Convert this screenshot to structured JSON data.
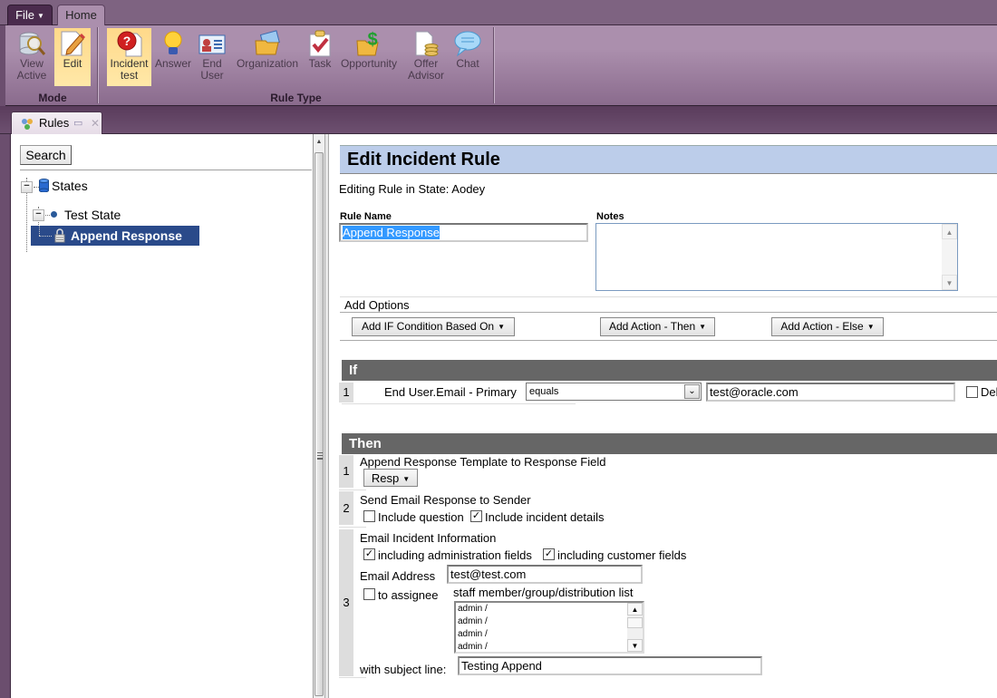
{
  "ribbon": {
    "file_tab": "File",
    "home_tab": "Home",
    "mode_group": {
      "label": "Mode",
      "buttons": [
        {
          "icon": "view-active-icon",
          "line1": "View",
          "line2": "Active",
          "active": false
        },
        {
          "icon": "edit-icon",
          "line1": "Edit",
          "line2": "",
          "active": true
        }
      ]
    },
    "rule_type_group": {
      "label": "Rule Type",
      "buttons": [
        {
          "icon": "incident-icon",
          "line1": "Incident",
          "line2": "test",
          "active": true
        },
        {
          "icon": "answer-icon",
          "line1": "Answer",
          "line2": "",
          "active": false
        },
        {
          "icon": "end-user-icon",
          "line1": "End",
          "line2": "User",
          "active": false
        },
        {
          "icon": "organization-icon",
          "line1": "Organization",
          "line2": "",
          "active": false
        },
        {
          "icon": "task-icon",
          "line1": "Task",
          "line2": "",
          "active": false
        },
        {
          "icon": "opportunity-icon",
          "line1": "Opportunity",
          "line2": "",
          "active": false
        },
        {
          "icon": "offer-advisor-icon",
          "line1": "Offer",
          "line2": "Advisor",
          "active": false
        },
        {
          "icon": "chat-icon",
          "line1": "Chat",
          "line2": "",
          "active": false
        }
      ]
    }
  },
  "doc_tab": {
    "label": "Rules"
  },
  "left_panel": {
    "search_button": "Search",
    "tree": {
      "root": "States",
      "child": "Test State",
      "selected_leaf": "Append Response"
    }
  },
  "editor": {
    "title": "Edit Incident Rule",
    "state_line": "Editing Rule in State: Aodey",
    "rule_name_label": "Rule Name",
    "rule_name_value": "Append Response",
    "notes_label": "Notes",
    "notes_value": "",
    "add_options_label": "Add Options",
    "add_if_button": "Add IF Condition Based On",
    "add_then_button": "Add Action - Then",
    "add_else_button": "Add Action - Else",
    "if_section": {
      "header": "If",
      "conditions": [
        {
          "num": "1",
          "field": "End User.Email - Primary",
          "operator": "equals",
          "value": "test@oracle.com",
          "delete_label": "Del",
          "delete_checked": false
        }
      ]
    },
    "then_section": {
      "header": "Then",
      "actions": [
        {
          "num": "1",
          "title": "Append Response Template to Response Field",
          "dropdown": "Resp"
        },
        {
          "num": "2",
          "title": "Send Email Response to Sender",
          "options": [
            {
              "label": "Include question",
              "checked": false
            },
            {
              "label": "Include incident details",
              "checked": true
            }
          ]
        },
        {
          "num": "3",
          "title": "Email Incident Information",
          "options": [
            {
              "label": "including administration fields",
              "checked": true
            },
            {
              "label": "including customer fields",
              "checked": true
            }
          ],
          "email_label": "Email Address",
          "email_value": "test@test.com",
          "assignee_label": "to assignee",
          "assignee_checked": false,
          "staff_label": "staff member/group/distribution list",
          "staff_list": [
            "admin /",
            "admin /",
            "admin /",
            "admin /"
          ],
          "subject_label": "with subject line:",
          "subject_value": "Testing Append"
        }
      ]
    }
  }
}
